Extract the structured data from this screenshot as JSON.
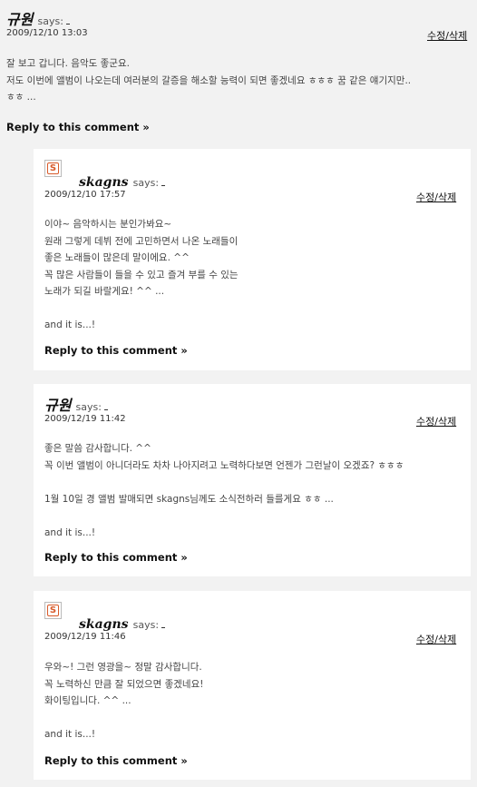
{
  "top_comment": {
    "author": "규원",
    "says": "says:",
    "date": "2009/12/10 13:03",
    "edit_label": "수정/삭제",
    "lines": [
      "잘 보고 갑니다. 음악도 좋군요.",
      "저도 이번에 앨범이 나오는데 여러분의 갈증을 해소할 능력이 되면 좋겠네요 ㅎㅎㅎ 꿈 같은 얘기지만..",
      "ㅎㅎ ..."
    ],
    "reply_label": "Reply to this comment »"
  },
  "replies": [
    {
      "author": "skagns",
      "has_avatar": true,
      "avatar_letter": "S",
      "says": "says:",
      "date": "2009/12/10 17:57",
      "edit_label": "수정/삭제",
      "lines": [
        "이야~ 음악하시는 분인가봐요~",
        "원래 그렇게 데뷔 전에 고민하면서 나온 노래들이",
        "좋은 노래들이 많은데 말이에요. ^^",
        "꼭 많은 사람들이 들을 수 있고 즐겨 부를 수 있는",
        "노래가 되길 바랄게요! ^^ ...",
        "",
        "and it is...!"
      ],
      "reply_label": "Reply to this comment »"
    },
    {
      "author": "규원",
      "has_avatar": false,
      "says": "says:",
      "date": "2009/12/19 11:42",
      "edit_label": "수정/삭제",
      "lines": [
        "좋은 말씀 감사합니다. ^^",
        "꼭 이번 앨범이 아니더라도 차차 나아지려고 노력하다보면 언젠가 그런날이 오겠죠? ㅎㅎㅎ",
        "",
        "1월 10일 경 앨범 발매되면 skagns님께도 소식전하러 들를게요 ㅎㅎ ...",
        "",
        "and it is...!"
      ],
      "reply_label": "Reply to this comment »"
    },
    {
      "author": "skagns",
      "has_avatar": true,
      "avatar_letter": "S",
      "says": "says:",
      "date": "2009/12/19 11:46",
      "edit_label": "수정/삭제",
      "lines": [
        "우와~! 그런 영광을~ 정말 감사합니다.",
        "꼭 노력하신 만큼 잘 되었으면 좋겠네요!",
        "화이팅입니다. ^^ ...",
        "",
        "and it is...!"
      ],
      "reply_label": "Reply to this comment »"
    }
  ]
}
